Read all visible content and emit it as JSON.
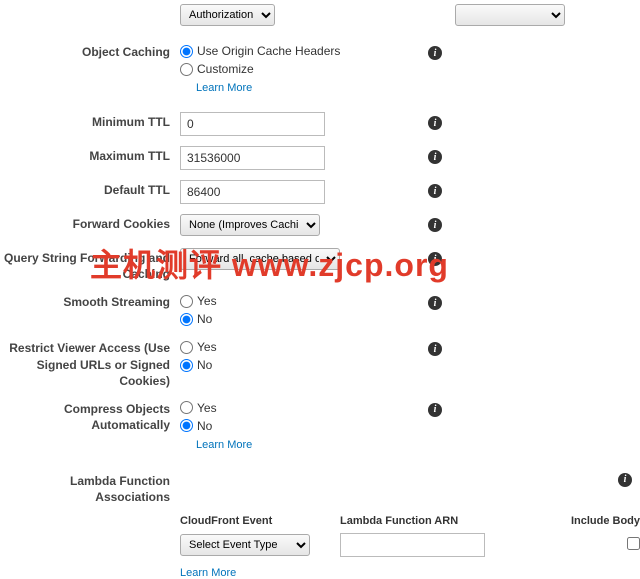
{
  "topSelect": {
    "option": "Authorization"
  },
  "rightSelect": {
    "option": ""
  },
  "objectCaching": {
    "label": "Object Caching",
    "opt1": "Use Origin Cache Headers",
    "opt2": "Customize",
    "learn": "Learn More"
  },
  "minTTL": {
    "label": "Minimum TTL",
    "value": "0"
  },
  "maxTTL": {
    "label": "Maximum TTL",
    "value": "31536000"
  },
  "defTTL": {
    "label": "Default TTL",
    "value": "86400"
  },
  "forwardCookies": {
    "label": "Forward Cookies",
    "option": "None (Improves Caching)"
  },
  "queryString": {
    "label": "Query String Forwarding and Caching",
    "option": "Forward all, cache based on all"
  },
  "smoothStreaming": {
    "label": "Smooth Streaming",
    "yes": "Yes",
    "no": "No"
  },
  "restrictViewer": {
    "label": "Restrict Viewer Access (Use Signed URLs or Signed Cookies)",
    "yes": "Yes",
    "no": "No"
  },
  "compress": {
    "label": "Compress Objects Automatically",
    "yes": "Yes",
    "no": "No",
    "learn": "Learn More"
  },
  "lambda": {
    "label": "Lambda Function Associations",
    "col1": "CloudFront Event",
    "col2": "Lambda Function ARN",
    "col3": "Include Body",
    "eventSelect": "Select Event Type",
    "arn": "",
    "learn": "Learn More"
  },
  "watermark": "主机测评  www.zjcp.org"
}
